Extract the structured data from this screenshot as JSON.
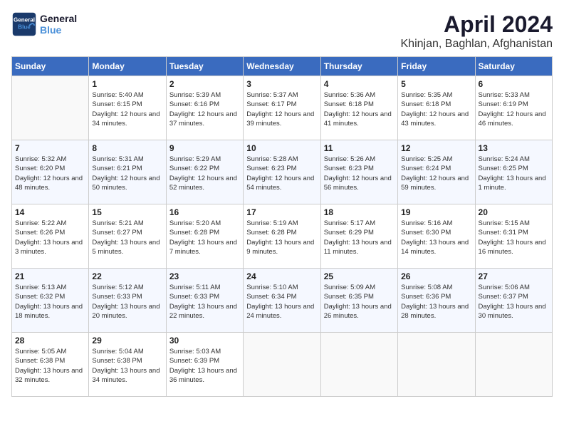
{
  "header": {
    "logo_line1": "General",
    "logo_line2": "Blue",
    "month": "April 2024",
    "location": "Khinjan, Baghlan, Afghanistan"
  },
  "weekdays": [
    "Sunday",
    "Monday",
    "Tuesday",
    "Wednesday",
    "Thursday",
    "Friday",
    "Saturday"
  ],
  "weeks": [
    [
      {
        "day": "",
        "sunrise": "",
        "sunset": "",
        "daylight": ""
      },
      {
        "day": "1",
        "sunrise": "5:40 AM",
        "sunset": "6:15 PM",
        "daylight": "12 hours and 34 minutes."
      },
      {
        "day": "2",
        "sunrise": "5:39 AM",
        "sunset": "6:16 PM",
        "daylight": "12 hours and 37 minutes."
      },
      {
        "day": "3",
        "sunrise": "5:37 AM",
        "sunset": "6:17 PM",
        "daylight": "12 hours and 39 minutes."
      },
      {
        "day": "4",
        "sunrise": "5:36 AM",
        "sunset": "6:18 PM",
        "daylight": "12 hours and 41 minutes."
      },
      {
        "day": "5",
        "sunrise": "5:35 AM",
        "sunset": "6:18 PM",
        "daylight": "12 hours and 43 minutes."
      },
      {
        "day": "6",
        "sunrise": "5:33 AM",
        "sunset": "6:19 PM",
        "daylight": "12 hours and 46 minutes."
      }
    ],
    [
      {
        "day": "7",
        "sunrise": "5:32 AM",
        "sunset": "6:20 PM",
        "daylight": "12 hours and 48 minutes."
      },
      {
        "day": "8",
        "sunrise": "5:31 AM",
        "sunset": "6:21 PM",
        "daylight": "12 hours and 50 minutes."
      },
      {
        "day": "9",
        "sunrise": "5:29 AM",
        "sunset": "6:22 PM",
        "daylight": "12 hours and 52 minutes."
      },
      {
        "day": "10",
        "sunrise": "5:28 AM",
        "sunset": "6:23 PM",
        "daylight": "12 hours and 54 minutes."
      },
      {
        "day": "11",
        "sunrise": "5:26 AM",
        "sunset": "6:23 PM",
        "daylight": "12 hours and 56 minutes."
      },
      {
        "day": "12",
        "sunrise": "5:25 AM",
        "sunset": "6:24 PM",
        "daylight": "12 hours and 59 minutes."
      },
      {
        "day": "13",
        "sunrise": "5:24 AM",
        "sunset": "6:25 PM",
        "daylight": "13 hours and 1 minute."
      }
    ],
    [
      {
        "day": "14",
        "sunrise": "5:22 AM",
        "sunset": "6:26 PM",
        "daylight": "13 hours and 3 minutes."
      },
      {
        "day": "15",
        "sunrise": "5:21 AM",
        "sunset": "6:27 PM",
        "daylight": "13 hours and 5 minutes."
      },
      {
        "day": "16",
        "sunrise": "5:20 AM",
        "sunset": "6:28 PM",
        "daylight": "13 hours and 7 minutes."
      },
      {
        "day": "17",
        "sunrise": "5:19 AM",
        "sunset": "6:28 PM",
        "daylight": "13 hours and 9 minutes."
      },
      {
        "day": "18",
        "sunrise": "5:17 AM",
        "sunset": "6:29 PM",
        "daylight": "13 hours and 11 minutes."
      },
      {
        "day": "19",
        "sunrise": "5:16 AM",
        "sunset": "6:30 PM",
        "daylight": "13 hours and 14 minutes."
      },
      {
        "day": "20",
        "sunrise": "5:15 AM",
        "sunset": "6:31 PM",
        "daylight": "13 hours and 16 minutes."
      }
    ],
    [
      {
        "day": "21",
        "sunrise": "5:13 AM",
        "sunset": "6:32 PM",
        "daylight": "13 hours and 18 minutes."
      },
      {
        "day": "22",
        "sunrise": "5:12 AM",
        "sunset": "6:33 PM",
        "daylight": "13 hours and 20 minutes."
      },
      {
        "day": "23",
        "sunrise": "5:11 AM",
        "sunset": "6:33 PM",
        "daylight": "13 hours and 22 minutes."
      },
      {
        "day": "24",
        "sunrise": "5:10 AM",
        "sunset": "6:34 PM",
        "daylight": "13 hours and 24 minutes."
      },
      {
        "day": "25",
        "sunrise": "5:09 AM",
        "sunset": "6:35 PM",
        "daylight": "13 hours and 26 minutes."
      },
      {
        "day": "26",
        "sunrise": "5:08 AM",
        "sunset": "6:36 PM",
        "daylight": "13 hours and 28 minutes."
      },
      {
        "day": "27",
        "sunrise": "5:06 AM",
        "sunset": "6:37 PM",
        "daylight": "13 hours and 30 minutes."
      }
    ],
    [
      {
        "day": "28",
        "sunrise": "5:05 AM",
        "sunset": "6:38 PM",
        "daylight": "13 hours and 32 minutes."
      },
      {
        "day": "29",
        "sunrise": "5:04 AM",
        "sunset": "6:38 PM",
        "daylight": "13 hours and 34 minutes."
      },
      {
        "day": "30",
        "sunrise": "5:03 AM",
        "sunset": "6:39 PM",
        "daylight": "13 hours and 36 minutes."
      },
      {
        "day": "",
        "sunrise": "",
        "sunset": "",
        "daylight": ""
      },
      {
        "day": "",
        "sunrise": "",
        "sunset": "",
        "daylight": ""
      },
      {
        "day": "",
        "sunrise": "",
        "sunset": "",
        "daylight": ""
      },
      {
        "day": "",
        "sunrise": "",
        "sunset": "",
        "daylight": ""
      }
    ]
  ],
  "labels": {
    "sunrise_prefix": "Sunrise: ",
    "sunset_prefix": "Sunset: ",
    "daylight_prefix": "Daylight: "
  }
}
